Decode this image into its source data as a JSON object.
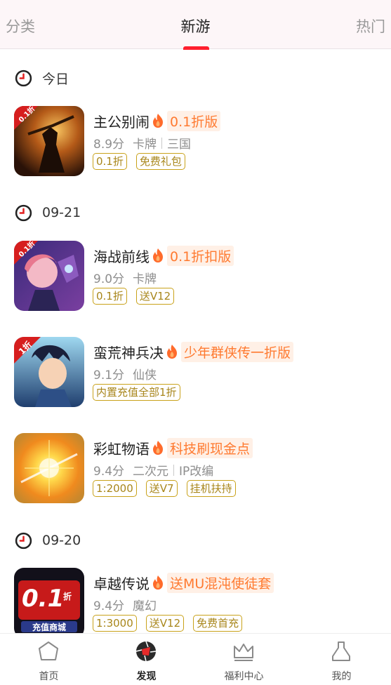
{
  "top_tabs": {
    "left": "分类",
    "center": "新游",
    "right": "热门",
    "active": "新游"
  },
  "sections": [
    {
      "date": "今日",
      "games": [
        {
          "name": "主公别闹",
          "promo": "0.1折版",
          "score": "8.9分",
          "meta": [
            "卡牌",
            "三国"
          ],
          "tags": [
            "0.1折",
            "免费礼包"
          ],
          "icon": "warrior-game-icon"
        }
      ]
    },
    {
      "date": "09-21",
      "games": [
        {
          "name": "海战前线",
          "promo": "0.1折扣版",
          "score": "9.0分",
          "meta": [
            "卡牌"
          ],
          "tags": [
            "0.1折",
            "送V12"
          ],
          "icon": "anime-girl-game-icon"
        },
        {
          "name": "蛮荒神兵决",
          "promo": "少年群侠传一折版",
          "score": "9.1分",
          "meta": [
            "仙侠"
          ],
          "tags": [
            "内置充值全部1折"
          ],
          "icon": "hero-game-icon"
        },
        {
          "name": "彩虹物语",
          "promo": "科技刷现金点",
          "score": "9.4分",
          "meta": [
            "二次元",
            "IP改编"
          ],
          "tags": [
            "1:2000",
            "送V7",
            "挂机扶持"
          ],
          "icon": "light-orb-game-icon"
        }
      ]
    },
    {
      "date": "09-20",
      "games": [
        {
          "name": "卓越传说",
          "promo": "送MU混沌使徒套",
          "score": "9.4分",
          "meta": [
            "魔幻"
          ],
          "tags": [
            "1:3000",
            "送V12",
            "免费首充"
          ],
          "icon": "shop-game-icon"
        }
      ]
    }
  ],
  "icon_badges": {
    "g0": "0.1折",
    "g1": "0.1折",
    "g2": "1折",
    "g4_big": "0.1",
    "g4_small": "折",
    "g4_sub": "充值商城"
  },
  "bottom_nav": [
    {
      "label": "首页",
      "icon": "home-icon"
    },
    {
      "label": "发现",
      "icon": "discover-icon"
    },
    {
      "label": "福利中心",
      "icon": "crown-icon"
    },
    {
      "label": "我的",
      "icon": "profile-icon"
    }
  ],
  "active_nav": "发现",
  "colors": {
    "accent_red": "#ff1f2e",
    "promo_orange": "#ff7a30",
    "tag_gold": "#c9a21a",
    "topbar_bg": "#fdf6f8"
  }
}
